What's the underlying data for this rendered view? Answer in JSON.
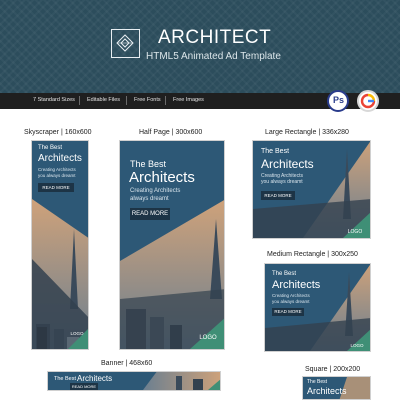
{
  "header": {
    "title": "ARCHITECT",
    "subtitle": "HTML5 Animated Ad Template"
  },
  "features": [
    "7 Standard Sizes",
    "Editable Files",
    "Free Fonts",
    "Free Images"
  ],
  "badges": {
    "ps_label": "Ps",
    "gw_icon": "google-web-designer-icon"
  },
  "ad_copy": {
    "the_best": "The Best",
    "architects": "Architects",
    "desc_line1": "Creating Architects",
    "desc_line2": "you always dreamt",
    "desc_line2b": "always dreamt",
    "read_more": "READ MORE",
    "logo": "LOGO"
  },
  "units": {
    "skyscraper": "Skyscraper | 160x600",
    "half_page": "Half Page | 300x600",
    "large_rect": "Large Rectangle | 336x280",
    "medium_rect": "Medium Rectangle | 300x250",
    "banner": "Banner | 468x60",
    "square": "Square | 200x200"
  },
  "colors": {
    "header_bg": "#2c4d5c",
    "ad_blue": "#2d5876",
    "ad_green": "#3f8f76"
  }
}
